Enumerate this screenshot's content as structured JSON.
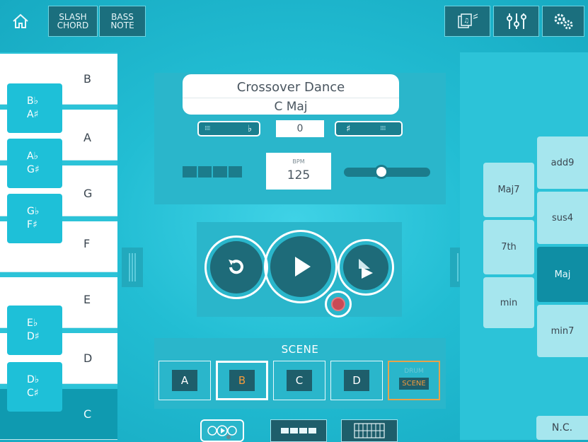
{
  "topbar": {
    "slash_chord": [
      "SLASH",
      "CHORD"
    ],
    "bass_note": [
      "BASS",
      "NOTE"
    ],
    "icons": [
      "home-icon",
      "song-library-icon",
      "mixer-icon",
      "settings-icon"
    ]
  },
  "keyboard": {
    "white_keys": [
      "B",
      "A",
      "G",
      "F",
      "E",
      "D",
      "C"
    ],
    "active_key": "C",
    "black_keys": [
      {
        "flat": "B♭",
        "sharp": "A♯"
      },
      {
        "flat": "A♭",
        "sharp": "G♯"
      },
      {
        "flat": "G♭",
        "sharp": "F♯"
      },
      {
        "flat": "E♭",
        "sharp": "D♯"
      },
      {
        "flat": "D♭",
        "sharp": "C♯"
      }
    ]
  },
  "song": {
    "title": "Crossover Dance",
    "key": "C Maj",
    "flat_symbol": "♭",
    "sharp_symbol": "♯",
    "transpose": "0",
    "bpm_label": "BPM",
    "bpm": "125",
    "tempo_level": 0.42
  },
  "scene": {
    "title": "SCENE",
    "buttons": [
      "A",
      "B",
      "C",
      "D"
    ],
    "selected": "B",
    "drum_top": "DRUM",
    "drum_bottom": "SCENE"
  },
  "chord_types": {
    "column1": [
      "Maj7",
      "7th",
      "min"
    ],
    "column2": [
      "add9",
      "sus4",
      "Maj",
      "min7"
    ],
    "active": "Maj",
    "nc": "N.C."
  },
  "colors": {
    "accent_dark": "#1e5e6b",
    "selected_scene": "#f29a3b",
    "active_key": "#0f9ab0",
    "record": "#c94a55"
  }
}
